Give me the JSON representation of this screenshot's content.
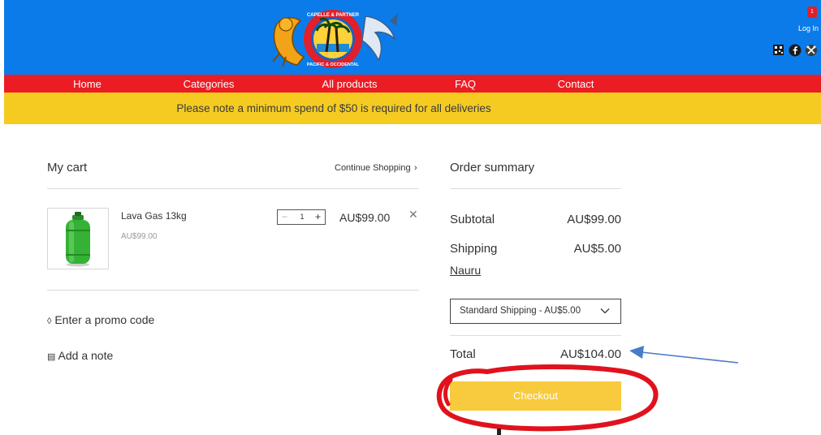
{
  "header": {
    "cart_count": "1",
    "login_label": "Log In",
    "logo_text": "CAPELLE & PARTNER PACIFIC & OCCIDENTAL",
    "icons": [
      "qr-code-icon",
      "facebook-icon",
      "crossed-tools-icon"
    ]
  },
  "nav": {
    "items": [
      "Home",
      "Categories",
      "All products",
      "FAQ",
      "Contact"
    ]
  },
  "notice": {
    "text": "Please note a minimum spend of $50 is required for all deliveries"
  },
  "cart": {
    "title": "My cart",
    "continue_label": "Continue Shopping",
    "items": [
      {
        "name": "Lava Gas 13kg",
        "unit_price": "AU$99.00",
        "quantity": "1",
        "line_total": "AU$99.00"
      }
    ],
    "promo_label": "Enter a promo code",
    "note_label": "Add a note"
  },
  "summary": {
    "title": "Order summary",
    "subtotal_label": "Subtotal",
    "subtotal_value": "AU$99.00",
    "shipping_label": "Shipping",
    "shipping_value": "AU$5.00",
    "shipping_country": "Nauru",
    "shipping_option": "Standard Shipping - AU$5.00",
    "total_label": "Total",
    "total_value": "AU$104.00",
    "checkout_label": "Checkout"
  },
  "colors": {
    "header_blue": "#0b7bea",
    "nav_red": "#ec1c24",
    "notice_yellow": "#f5cb22",
    "checkout_yellow": "#f7cb3d",
    "annotation_red": "#e0121c",
    "annotation_blue": "#4a7bc8"
  }
}
